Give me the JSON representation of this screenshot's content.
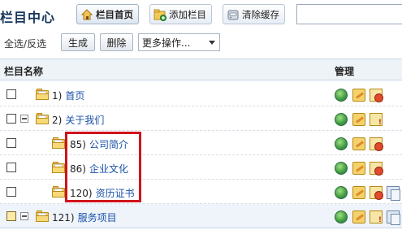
{
  "header": {
    "title": "栏目中心",
    "buttons": [
      {
        "label": "栏目首页",
        "icon": "home-icon",
        "active": true
      },
      {
        "label": "添加栏目",
        "icon": "add-folder-icon",
        "active": false
      },
      {
        "label": "清除缓存",
        "icon": "clear-cache-icon",
        "active": false
      }
    ],
    "search": {
      "value": "",
      "placeholder": ""
    }
  },
  "toolbar": {
    "select_all": "全选",
    "separator": "/",
    "invert": "反选",
    "generate_label": "生成",
    "delete_label": "删除",
    "more_actions": "更多操作..."
  },
  "table": {
    "col_name": "栏目名称",
    "col_manage": "管理",
    "rows": [
      {
        "id": "1)",
        "name": "首页",
        "expanded": null,
        "level": 0,
        "manage": [
          "globe-icon",
          "edit-icon",
          "delete-icon"
        ]
      },
      {
        "id": "2)",
        "name": "关于我们",
        "expanded": true,
        "level": 0,
        "manage": [
          "globe-icon",
          "edit-icon",
          "warning-icon"
        ]
      },
      {
        "id": "85)",
        "name": "公司简介",
        "expanded": null,
        "level": 1,
        "manage": [
          "globe-icon",
          "edit-icon",
          "delete-icon"
        ]
      },
      {
        "id": "86)",
        "name": "企业文化",
        "expanded": null,
        "level": 1,
        "manage": [
          "globe-icon",
          "edit-icon",
          "delete-icon"
        ]
      },
      {
        "id": "120)",
        "name": "资历证书",
        "expanded": null,
        "level": 1,
        "manage": [
          "globe-icon",
          "edit-icon",
          "delete-icon",
          "copy-icon"
        ]
      },
      {
        "id": "121)",
        "name": "服务项目",
        "expanded": true,
        "level": 0,
        "manage": [
          "globe-icon",
          "edit-icon",
          "warning-icon",
          "copy-icon"
        ]
      }
    ]
  },
  "colors": {
    "link": "#1a50a8",
    "title": "#16365c",
    "highlight": "#d0131b",
    "header_bg": "#eef3f8"
  }
}
